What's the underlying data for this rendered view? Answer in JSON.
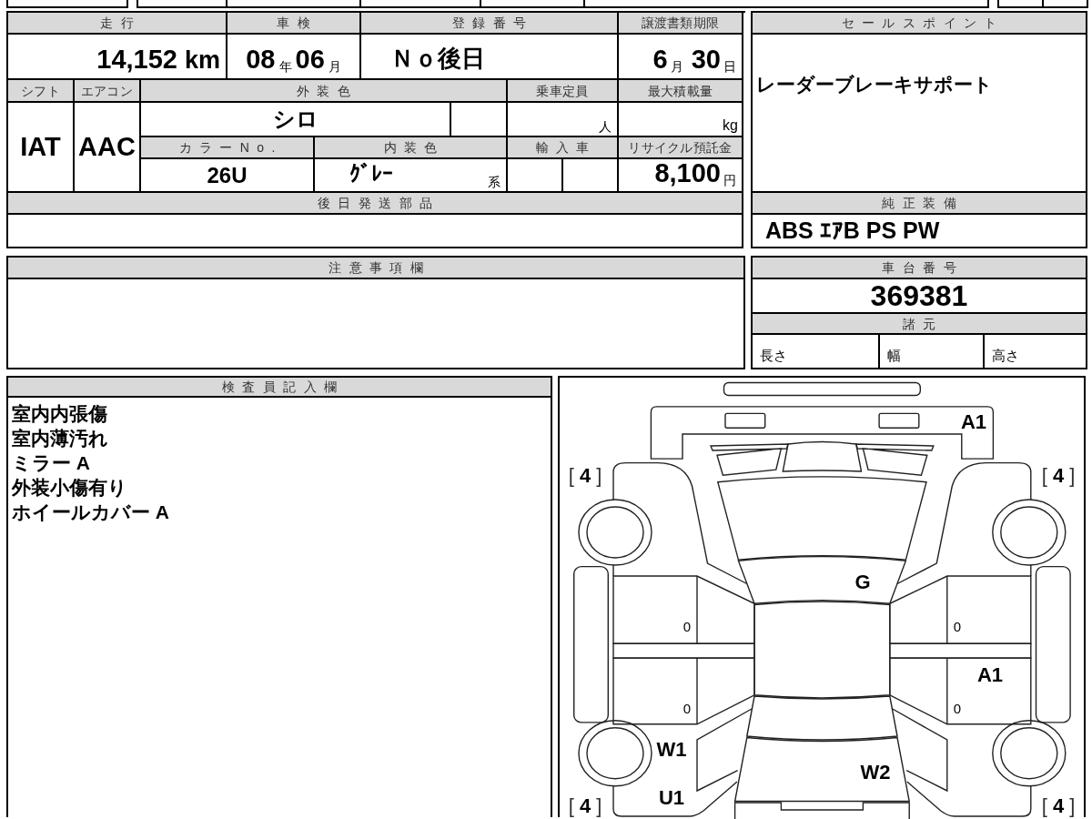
{
  "vehicle_info": {
    "mileage": {
      "label": "走行",
      "value": "14,152",
      "unit": "km"
    },
    "inspection": {
      "label": "車検",
      "year": "08",
      "year_unit": "年",
      "month": "06",
      "month_unit": "月"
    },
    "registration_number": {
      "label": "登録番号",
      "value": "Ｎｏ後日"
    },
    "transfer_deadline": {
      "label": "譲渡書類期限",
      "month": "6",
      "month_unit": "月",
      "day": "30",
      "day_unit": "日"
    },
    "shift": {
      "label": "シフト",
      "value": "IAT"
    },
    "air_conditioner": {
      "label": "エアコン",
      "value": "AAC"
    },
    "exterior_color": {
      "label": "外装色",
      "value": "シロ"
    },
    "seating_capacity": {
      "label": "乗車定員",
      "unit": "人"
    },
    "max_load": {
      "label": "最大積載量",
      "unit": "kg"
    },
    "color_number": {
      "label": "カラーNo.",
      "value": "26U"
    },
    "interior_color": {
      "label": "内装色",
      "value": "ｸﾞﾚｰ",
      "suffix": "系"
    },
    "imported": {
      "label": "輸入車"
    },
    "recycling_fee": {
      "label": "リサイクル預託金",
      "value": "8,100",
      "unit": "円"
    },
    "parts_shipped_later": {
      "label": "後日発送部品"
    }
  },
  "sales_points": {
    "label": "セールスポイント",
    "text": "レーダーブレーキサポート"
  },
  "standard_equipment": {
    "label": "純正装備",
    "text": "ABS ｴｱB PS PW"
  },
  "notes": {
    "label": "注意事項欄"
  },
  "chassis_number": {
    "label": "車台番号",
    "value": "369381"
  },
  "specifications": {
    "label": "諸元",
    "fields": [
      {
        "label": "長さ"
      },
      {
        "label": "幅"
      },
      {
        "label": "高さ"
      }
    ]
  },
  "inspector_remarks": {
    "label": "検査員記入欄",
    "lines": [
      "室内内張傷",
      "室内薄汚れ",
      "ミラー A",
      "外装小傷有り",
      "ホイールカバー A"
    ]
  },
  "condition_diagram": {
    "front_bumper": {
      "mark": "A1"
    },
    "windshield": {
      "mark": "G"
    },
    "left_front_door": {
      "code": "0"
    },
    "right_front_door": {
      "code": "0"
    },
    "left_rear_door": {
      "code": "0"
    },
    "right_rear_door": {
      "code": "0",
      "mark": "A1"
    },
    "left_rear_quarter": {
      "mark": "W1"
    },
    "trunk": {
      "mark": "W2"
    },
    "left_rear_bumper": {
      "mark": "U1"
    },
    "tires": {
      "front_left": "[ **4** ]",
      "front_right": "[ **4** ]",
      "rear_left": "[ **4** ]",
      "rear_right": "[ **4** ]"
    }
  }
}
